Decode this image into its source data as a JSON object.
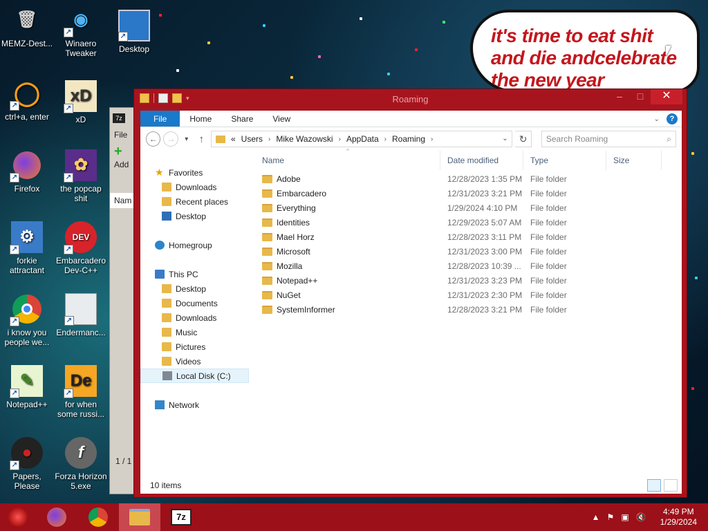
{
  "desktop": {
    "icons": [
      {
        "label": "MEMZ-Dest...",
        "icon": "recycle-bin-icon"
      },
      {
        "label": "Winaero Tweaker",
        "icon": "winaero-icon"
      },
      {
        "label": "Desktop",
        "icon": "monitor-icon"
      },
      {
        "label": "ctrl+a, enter",
        "icon": "ring-icon"
      },
      {
        "label": "xD",
        "icon": "hex-editor-icon"
      },
      {
        "label": "Firefox",
        "icon": "firefox-icon"
      },
      {
        "label": "the popcap shit",
        "icon": "popcap-icon"
      },
      {
        "label": "forkie attractant",
        "icon": "gear-computer-icon"
      },
      {
        "label": "Embarcadero Dev-C++",
        "icon": "devcpp-icon"
      },
      {
        "label": "i know you people we...",
        "icon": "chrome-icon"
      },
      {
        "label": "Endermanc...",
        "icon": "window-icon"
      },
      {
        "label": "Notepad++",
        "icon": "notepadpp-icon"
      },
      {
        "label": "for when some russi...",
        "icon": "de-icon"
      },
      {
        "label": "Papers, Please",
        "icon": "papers-please-icon"
      },
      {
        "label": "Forza Horizon 5.exe",
        "icon": "flash-icon"
      }
    ],
    "bubble_lines": [
      "it's time to eat shit",
      "and die andcelebrate",
      "the new year"
    ]
  },
  "explorer": {
    "title": "Roaming",
    "ribbon_tabs": [
      "File",
      "Home",
      "Share",
      "View"
    ],
    "help": "?",
    "breadcrumb": [
      "«",
      "Users",
      "Mike Wazowski",
      "AppData",
      "Roaming"
    ],
    "search_placeholder": "Search Roaming",
    "nav": {
      "favorites": "Favorites",
      "favorites_items": [
        "Downloads",
        "Recent places",
        "Desktop"
      ],
      "homegroup": "Homegroup",
      "thispc": "This PC",
      "thispc_items": [
        "Desktop",
        "Documents",
        "Downloads",
        "Music",
        "Pictures",
        "Videos",
        "Local Disk (C:)"
      ],
      "network": "Network"
    },
    "columns": [
      "Name",
      "Date modified",
      "Type",
      "Size"
    ],
    "rows": [
      {
        "name": "Adobe",
        "date": "12/28/2023 1:35 PM",
        "type": "File folder"
      },
      {
        "name": "Embarcadero",
        "date": "12/31/2023 3:21 PM",
        "type": "File folder"
      },
      {
        "name": "Everything",
        "date": "1/29/2024 4:10 PM",
        "type": "File folder"
      },
      {
        "name": "Identities",
        "date": "12/29/2023 5:07 AM",
        "type": "File folder"
      },
      {
        "name": "Mael Horz",
        "date": "12/28/2023 3:11 PM",
        "type": "File folder"
      },
      {
        "name": "Microsoft",
        "date": "12/31/2023 3:00 PM",
        "type": "File folder"
      },
      {
        "name": "Mozilla",
        "date": "12/28/2023 10:39 ...",
        "type": "File folder"
      },
      {
        "name": "Notepad++",
        "date": "12/31/2023 3:23 PM",
        "type": "File folder"
      },
      {
        "name": "NuGet",
        "date": "12/31/2023 2:30 PM",
        "type": "File folder"
      },
      {
        "name": "SystemInformer",
        "date": "12/28/2023 3:21 PM",
        "type": "File folder"
      }
    ],
    "status": "10 items"
  },
  "bgwindow": {
    "app": "7z",
    "file_label": "File",
    "add_label": "Add",
    "name_label": "Nam",
    "page_label": "1 / 1"
  },
  "taskbar": {
    "items": [
      "start-icon",
      "firefox-icon",
      "chrome-icon",
      "file-explorer-icon",
      "7zip-icon"
    ],
    "time": "4:49 PM",
    "date": "1/29/2024",
    "colors": {
      "taskbar": "#9c1019",
      "accent": "#1979ca"
    }
  }
}
